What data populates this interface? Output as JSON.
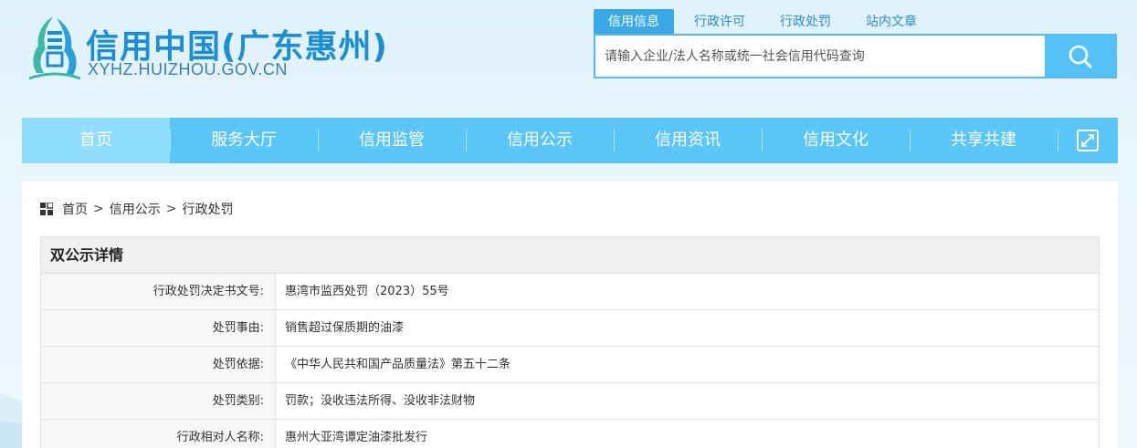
{
  "header": {
    "title": "信用中国(广东惠州)",
    "url": "XYHZ.HUIZHOU.GOV.CN"
  },
  "search": {
    "tabs": [
      "信用信息",
      "行政许可",
      "行政处罚",
      "站内文章"
    ],
    "active_tab": "信用信息",
    "placeholder": "请输入企业/法人名称或统一社会信用代码查询",
    "value": ""
  },
  "nav": {
    "items": [
      "首页",
      "服务大厅",
      "信用监管",
      "信用公示",
      "信用资讯",
      "信用文化",
      "共享共建"
    ],
    "active": "首页",
    "expand_icon": "expand-icon"
  },
  "breadcrumb": {
    "items": [
      "首页",
      "信用公示",
      "行政处罚"
    ],
    "separator": ">"
  },
  "detail": {
    "heading": "双公示详情",
    "rows": [
      {
        "label": "行政处罚决定书文号:",
        "value": "惠湾市监西处罚（2023）55号"
      },
      {
        "label": "处罚事由:",
        "value": "销售超过保质期的油漆"
      },
      {
        "label": "处罚依据:",
        "value": "《中华人民共和国产品质量法》第五十二条"
      },
      {
        "label": "处罚类别:",
        "value": "罚款；没收违法所得、没收非法财物"
      },
      {
        "label": "行政相对人名称:",
        "value": "惠州大亚湾谭定油漆批发行"
      }
    ]
  },
  "colors": {
    "brand": "#1b8fd4",
    "nav_bg": "#5ac6f7",
    "nav_active": "#8fdcfb",
    "search_border": "#55bdf5"
  }
}
